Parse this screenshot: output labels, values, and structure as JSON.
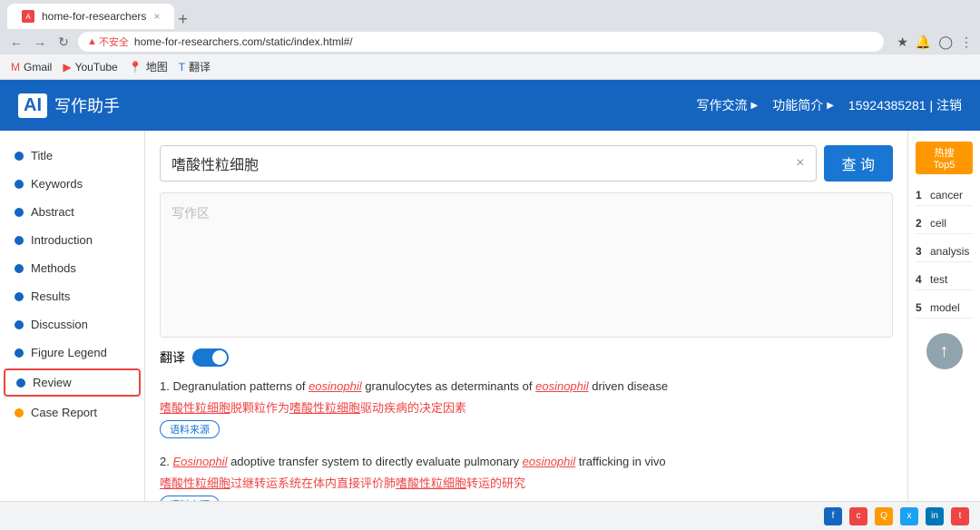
{
  "browser": {
    "tab_title": "home-for-researchers",
    "address": "home-for-researchers.com/static/index.html#/",
    "insecure_label": "不安全",
    "bookmarks": [
      {
        "label": "Gmail",
        "icon": "gmail"
      },
      {
        "label": "YouTube",
        "icon": "youtube"
      },
      {
        "label": "地图",
        "icon": "maps"
      },
      {
        "label": "翻译",
        "icon": "translate"
      }
    ]
  },
  "header": {
    "logo_ai": "AI",
    "logo_text": "写作助手",
    "nav_items": [
      "写作交流",
      "功能简介",
      "15924385281 | 注销"
    ],
    "arrow": "▶"
  },
  "sidebar": {
    "items": [
      {
        "label": "Title",
        "dot_color": "blue"
      },
      {
        "label": "Keywords",
        "dot_color": "blue"
      },
      {
        "label": "Abstract",
        "dot_color": "blue"
      },
      {
        "label": "Introduction",
        "dot_color": "blue"
      },
      {
        "label": "Methods",
        "dot_color": "blue"
      },
      {
        "label": "Results",
        "dot_color": "blue"
      },
      {
        "label": "Discussion",
        "dot_color": "blue"
      },
      {
        "label": "Figure Legend",
        "dot_color": "blue"
      },
      {
        "label": "Review",
        "dot_color": "blue",
        "active": true
      },
      {
        "label": "Case Report",
        "dot_color": "orange"
      }
    ]
  },
  "search": {
    "query": "嗜酸性粒细胞",
    "placeholder": "写作区",
    "query_button": "查 询",
    "clear_icon": "×"
  },
  "translation": {
    "label": "翻译",
    "enabled": true
  },
  "hot_top5": {
    "title": "热搜 Top5",
    "items": [
      {
        "rank": 1,
        "word": "cancer"
      },
      {
        "rank": 2,
        "word": "cell"
      },
      {
        "rank": 3,
        "word": "analysis"
      },
      {
        "rank": 4,
        "word": "test"
      },
      {
        "rank": 5,
        "word": "model"
      }
    ]
  },
  "results": [
    {
      "num": "1.",
      "en_before": "Degranulation patterns of ",
      "en_highlight1": "eosinophil",
      "en_mid": " granulocytes as determinants of ",
      "en_highlight2": "eosinophil",
      "en_after": " driven disease",
      "zh_before": "",
      "zh_highlight1": "嗜酸性粒细胞",
      "zh_mid": "脱颗粒作为",
      "zh_highlight2": "嗜酸性粒细胞",
      "zh_after": "驱动疾病的决定因素",
      "source": "语料来源"
    },
    {
      "num": "2.",
      "en_before": "",
      "en_highlight1": "Eosinophil",
      "en_mid": " adoptive transfer system to directly evaluate pulmonary ",
      "en_highlight2": "eosinophil",
      "en_after": " trafficking in vivo",
      "zh_before": "",
      "zh_highlight1": "嗜酸性粒细胞",
      "zh_mid": "过继转运系统在体内直接评价肺",
      "zh_highlight2": "嗜酸性粒细胞",
      "zh_after": "转运的研究",
      "source": "语料来源"
    }
  ],
  "scroll_top_icon": "↑",
  "bottom_icons": [
    "f",
    "c",
    "q",
    "x",
    "in",
    "t"
  ]
}
